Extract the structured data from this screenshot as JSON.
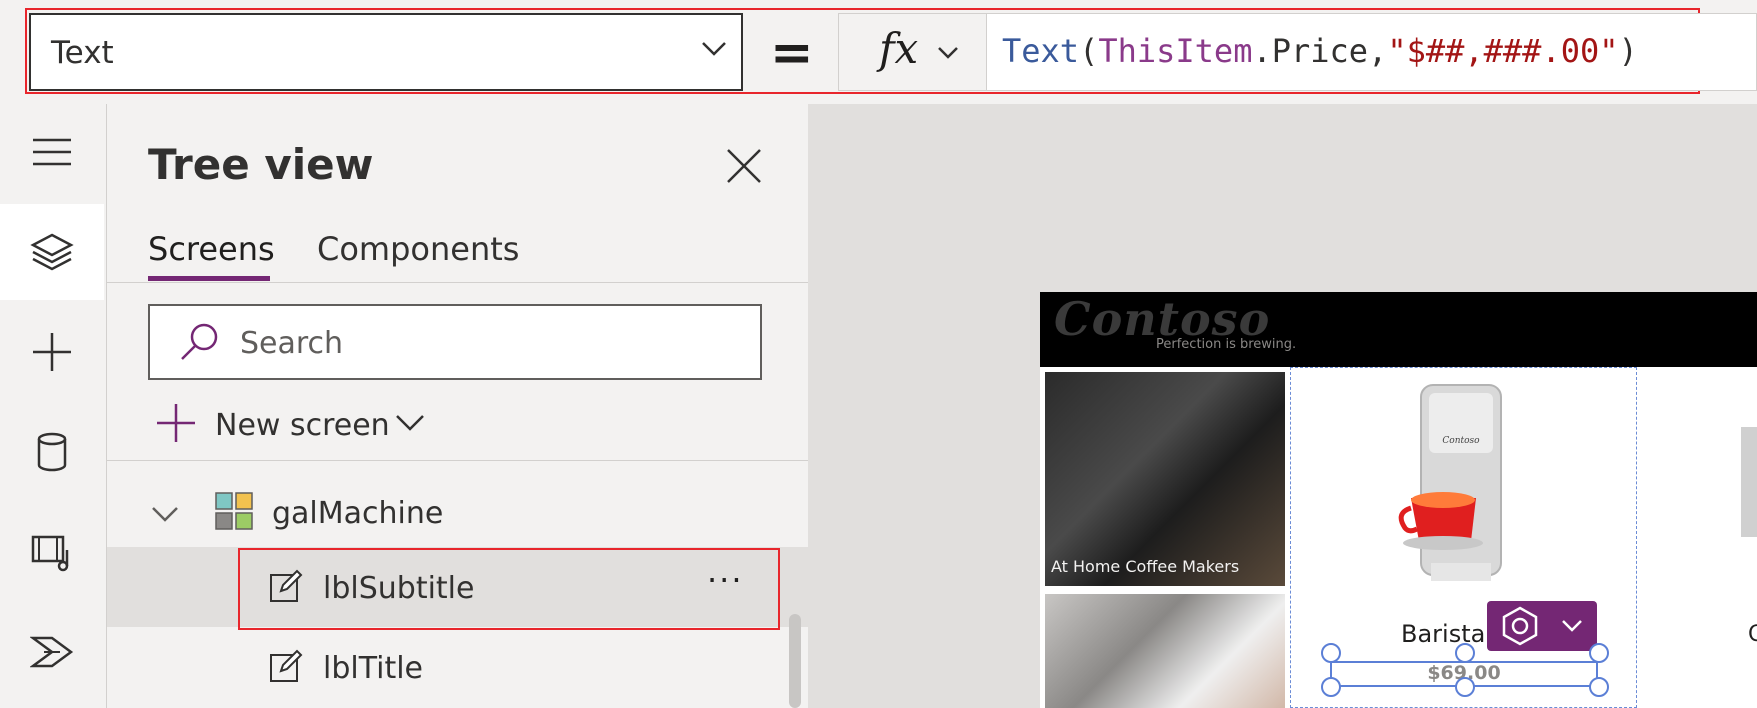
{
  "formula_bar": {
    "property_value": "Text",
    "equals": "=",
    "fx_label": "fx",
    "formula_tokens": [
      {
        "text": "Text",
        "kind": "function"
      },
      {
        "text": "(",
        "kind": "punct"
      },
      {
        "text": "ThisItem",
        "kind": "identifier"
      },
      {
        "text": ".Price",
        "kind": "punct"
      },
      {
        "text": ",",
        "kind": "punct"
      },
      {
        "text": "\"$##,###.00\"",
        "kind": "string"
      },
      {
        "text": ")",
        "kind": "punct"
      }
    ]
  },
  "left_rail": {
    "items": [
      {
        "icon": "hamburger-menu-icon"
      },
      {
        "icon": "layers-icon",
        "active": true
      },
      {
        "icon": "plus-icon"
      },
      {
        "icon": "database-icon"
      },
      {
        "icon": "media-icon"
      },
      {
        "icon": "power-automate-icon"
      }
    ]
  },
  "tree_view": {
    "title": "Tree view",
    "tabs": [
      {
        "label": "Screens",
        "active": true
      },
      {
        "label": "Components",
        "active": false
      }
    ],
    "search_placeholder": "Search",
    "new_screen_label": "New screen",
    "nodes": [
      {
        "label": "galMachine",
        "icon": "gallery-icon",
        "expanded": true
      },
      {
        "label": "lblSubtitle",
        "icon": "label-edit-icon",
        "selected": true
      },
      {
        "label": "lblTitle",
        "icon": "label-edit-icon",
        "selected": false
      }
    ],
    "more_label": "···"
  },
  "canvas": {
    "logo_text": "Contoso",
    "tagline": "Perfection is brewing.",
    "category_caption": "At Home Coffee Makers",
    "item_title": "Barista",
    "price_text": "$69",
    "price_suffix": ".00",
    "right_peek_text": "C"
  },
  "colors": {
    "accent": "#742774",
    "highlight": "#e8262c",
    "selection": "#5b7fd6"
  }
}
